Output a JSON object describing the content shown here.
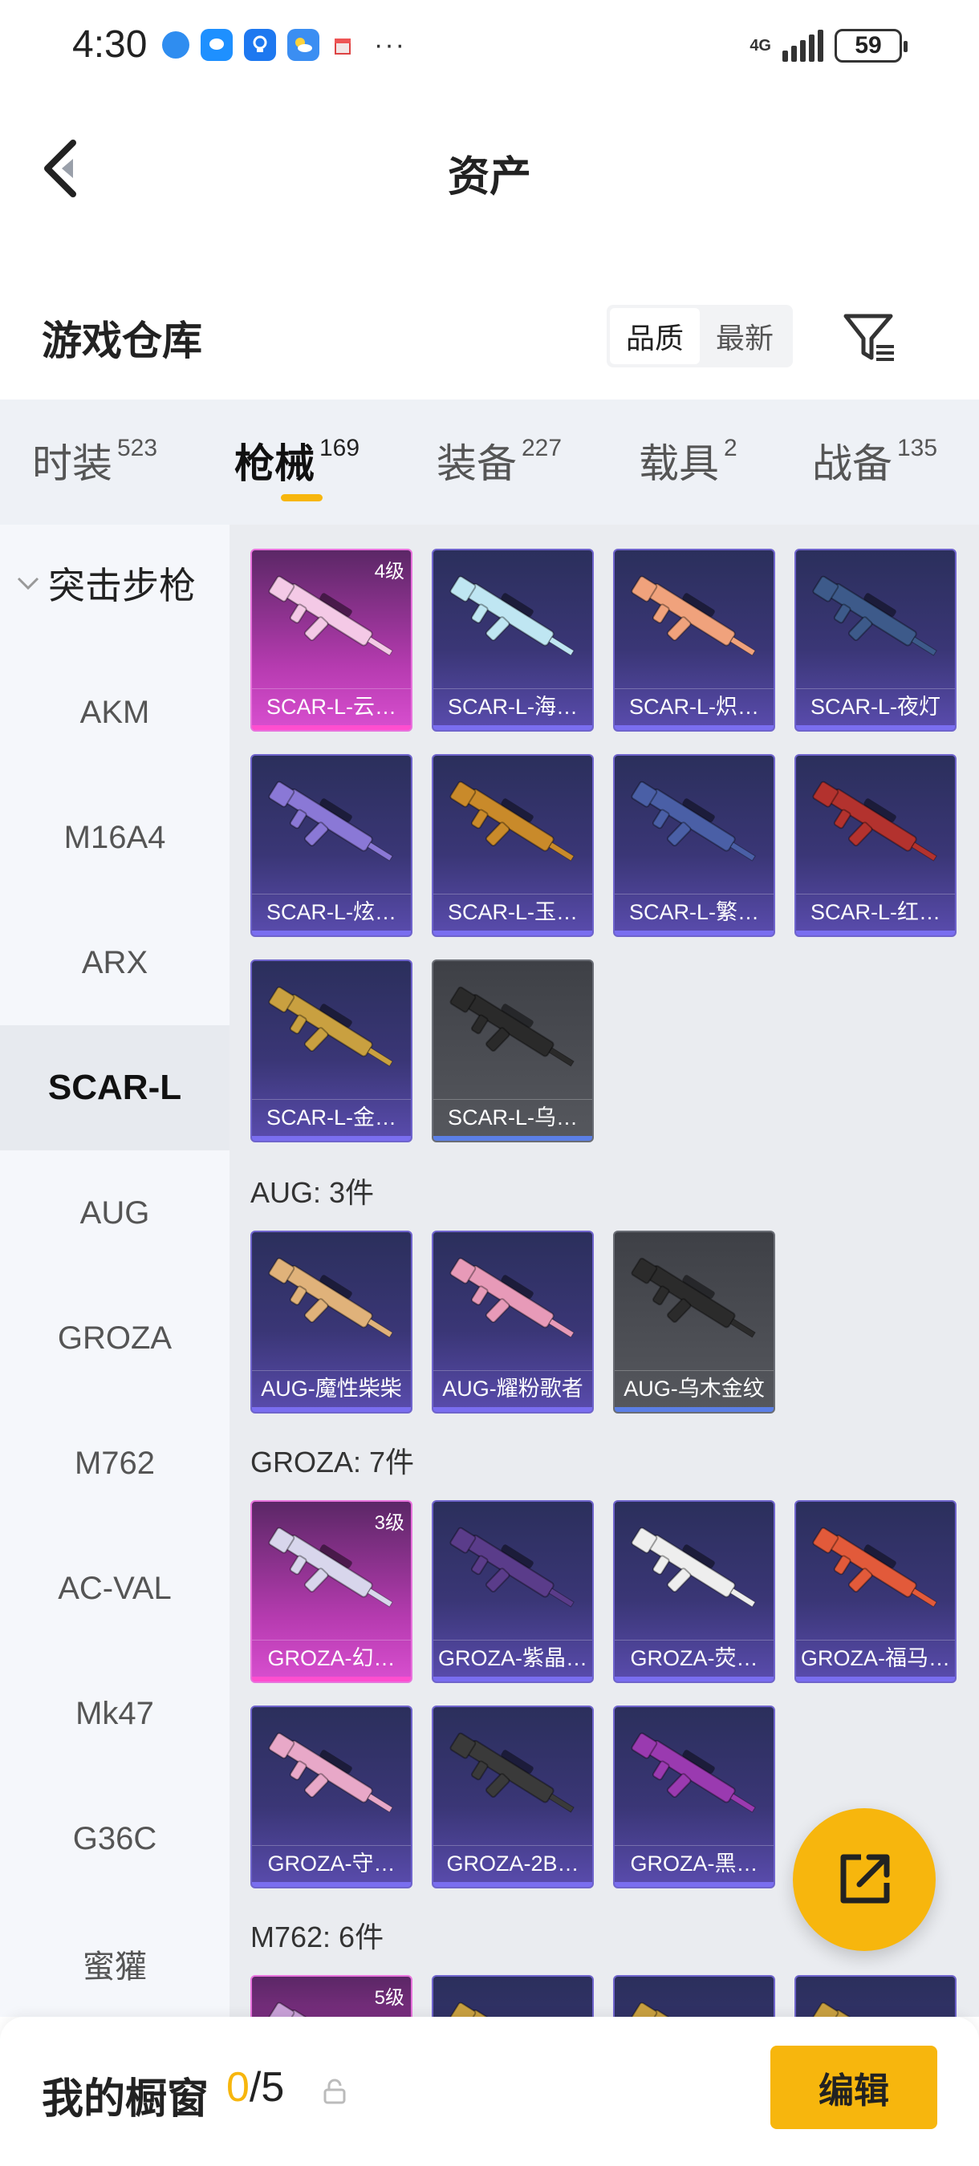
{
  "status_bar": {
    "time": "4:30",
    "network": "4G",
    "battery": "59"
  },
  "header": {
    "title": "资产"
  },
  "warehouse": {
    "title": "游戏仓库",
    "sort_options": [
      "品质",
      "最新"
    ],
    "sort_active": "品质"
  },
  "tabs": [
    {
      "label": "时装",
      "count": "523"
    },
    {
      "label": "枪械",
      "count": "169",
      "active": true
    },
    {
      "label": "装备",
      "count": "227"
    },
    {
      "label": "载具",
      "count": "2"
    },
    {
      "label": "战备",
      "count": "135"
    }
  ],
  "sidebar": {
    "group_label": "突击步枪",
    "items": [
      "AKM",
      "M16A4",
      "ARX",
      "SCAR-L",
      "AUG",
      "GROZA",
      "M762",
      "AC-VAL",
      "Mk47",
      "G36C",
      "蜜獾"
    ],
    "active": "SCAR-L"
  },
  "sections": {
    "scar": {
      "cards": [
        {
          "name": "SCAR-L-云…",
          "rarity": "pink",
          "level": "4级",
          "gun_color": "#f4c9e6"
        },
        {
          "name": "SCAR-L-海…",
          "rarity": "purple",
          "gun_color": "#bfe6f2"
        },
        {
          "name": "SCAR-L-炽…",
          "rarity": "purple",
          "gun_color": "#f0a27c"
        },
        {
          "name": "SCAR-L-夜灯",
          "rarity": "purple",
          "gun_color": "#3d5a8a"
        },
        {
          "name": "SCAR-L-炫…",
          "rarity": "purple",
          "gun_color": "#8a78d6"
        },
        {
          "name": "SCAR-L-玉…",
          "rarity": "purple",
          "gun_color": "#c98a2a"
        },
        {
          "name": "SCAR-L-繁…",
          "rarity": "purple",
          "gun_color": "#4a5fa6"
        },
        {
          "name": "SCAR-L-红…",
          "rarity": "purple",
          "gun_color": "#b3322e"
        },
        {
          "name": "SCAR-L-金…",
          "rarity": "purple",
          "gun_color": "#c9a040"
        },
        {
          "name": "SCAR-L-乌…",
          "rarity": "gray",
          "gun_color": "#2a2a2a"
        }
      ]
    },
    "aug": {
      "title": "AUG: 3件",
      "cards": [
        {
          "name": "AUG-魔性柴柴",
          "rarity": "purple",
          "gun_color": "#e0b27a"
        },
        {
          "name": "AUG-耀粉歌者",
          "rarity": "purple",
          "gun_color": "#e79ab8"
        },
        {
          "name": "AUG-乌木金纹",
          "rarity": "gray",
          "gun_color": "#2b2b2b"
        }
      ]
    },
    "groza": {
      "title": "GROZA: 7件",
      "cards": [
        {
          "name": "GROZA-幻…",
          "rarity": "pink",
          "level": "3级",
          "gun_color": "#d8d6ec"
        },
        {
          "name": "GROZA-紫晶…",
          "rarity": "purple",
          "gun_color": "#5a3c8a"
        },
        {
          "name": "GROZA-荧…",
          "rarity": "purple",
          "gun_color": "#eeeeee"
        },
        {
          "name": "GROZA-福马…",
          "rarity": "purple",
          "gun_color": "#e25a3a"
        },
        {
          "name": "GROZA-守…",
          "rarity": "purple",
          "gun_color": "#e8a8c8"
        },
        {
          "name": "GROZA-2B…",
          "rarity": "purple",
          "gun_color": "#3a3a3a"
        },
        {
          "name": "GROZA-黑…",
          "rarity": "purple",
          "gun_color": "#9a3ab0"
        }
      ]
    },
    "m762": {
      "title": "M762: 6件",
      "cards": [
        {
          "name": "",
          "rarity": "pink",
          "level": "5级",
          "gun_color": "#c9a0d8"
        },
        {
          "name": "",
          "rarity": "purple",
          "gun_color": "#c9a040"
        },
        {
          "name": "",
          "rarity": "purple",
          "gun_color": "#c9a040"
        },
        {
          "name": "",
          "rarity": "purple",
          "gun_color": "#c9a040"
        }
      ]
    }
  },
  "showcase": {
    "label": "我的橱窗",
    "current": "0",
    "total": "/5",
    "edit_label": "编辑"
  },
  "colors": {
    "accent": "#f7b60d",
    "rare_pink": "#d94fd0",
    "rare_purple": "#5a4cae",
    "rare_gray": "#56585e"
  }
}
